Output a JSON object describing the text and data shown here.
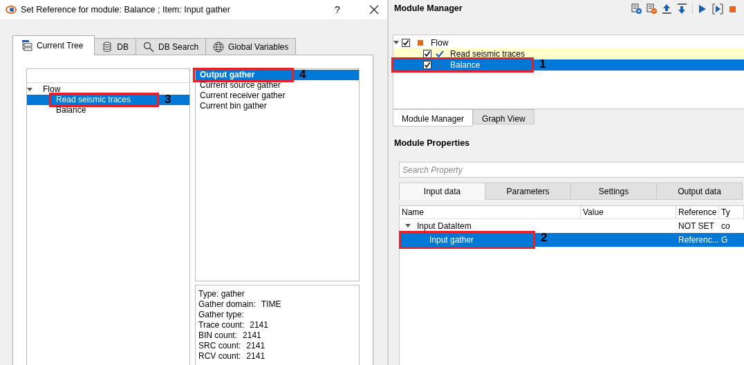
{
  "dialog": {
    "title": "Set Reference for module: Balance ; Item: Input gather",
    "help": "?",
    "tabs": [
      {
        "label": "Current Tree",
        "selected": true
      },
      {
        "label": "DB",
        "selected": false
      },
      {
        "label": "DB Search",
        "selected": false
      },
      {
        "label": "Global Variables",
        "selected": false
      }
    ],
    "tree": [
      {
        "label": "Flow",
        "expanded": true,
        "selected": false,
        "children": [
          {
            "label": "Read seismic traces",
            "selected": true,
            "callout": "3"
          },
          {
            "label": "Balance",
            "selected": false
          }
        ]
      }
    ],
    "gathers": [
      {
        "label": "Output gather",
        "selected": true,
        "callout": "4"
      },
      {
        "label": "Current source gather",
        "selected": false
      },
      {
        "label": "Current receiver gather",
        "selected": false
      },
      {
        "label": "Current bin gather",
        "selected": false
      }
    ],
    "info": [
      {
        "label": "Type: gather"
      },
      {
        "label": "Gather domain:",
        "value": "TIME"
      },
      {
        "label": "Gather type:"
      },
      {
        "label": "Trace count:",
        "value": "2141"
      },
      {
        "label": "BIN count:",
        "value": "2141"
      },
      {
        "label": "SRC count:",
        "value": "2141"
      },
      {
        "label": "RCV count:",
        "value": "2141"
      }
    ]
  },
  "module_manager": {
    "title": "Module Manager",
    "tree": [
      {
        "label": "Flow",
        "kind": "flow",
        "checked": true,
        "expanded": true,
        "selected": false,
        "children": [
          {
            "label": "Read seismic traces",
            "kind": "module",
            "checked": true,
            "highlighted": true,
            "selected": false
          },
          {
            "label": "Balance",
            "kind": "module",
            "checked": true,
            "highlighted": false,
            "selected": true,
            "callout": "1"
          }
        ]
      }
    ],
    "tabs": [
      {
        "label": "Module Manager",
        "selected": true
      },
      {
        "label": "Graph View",
        "selected": false
      }
    ]
  },
  "module_properties": {
    "title": "Module Properties",
    "search": {
      "placeholder": "Search Property"
    },
    "tabs": [
      {
        "label": "Input data",
        "selected": true
      },
      {
        "label": "Parameters",
        "selected": false
      },
      {
        "label": "Settings",
        "selected": false
      },
      {
        "label": "Output data",
        "selected": false
      }
    ],
    "columns": [
      "Name",
      "Value",
      "Reference",
      "Ty"
    ],
    "rows": [
      {
        "name": "Input DataItem",
        "reference": "NOT SET",
        "type": "co",
        "expanded": true,
        "selected": false,
        "children": [
          {
            "name": "Input gather",
            "reference": "Referenc...",
            "type": "G",
            "selected": true,
            "callout": "2"
          }
        ]
      }
    ]
  }
}
